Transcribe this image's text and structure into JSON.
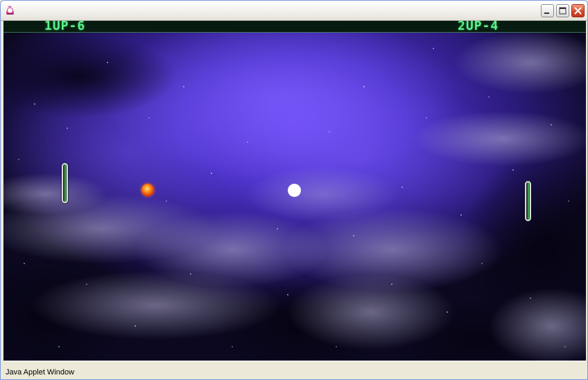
{
  "window": {
    "title": "",
    "status_text": "Java Applet Window"
  },
  "hud": {
    "player1_label": "1UP",
    "player1_score": 6,
    "player1_text": "1UP-6",
    "player2_label": "2UP",
    "player2_score": 4,
    "player2_text": "2UP-4"
  },
  "objects": {
    "left_paddle": "green-capsule-paddle",
    "right_paddle": "green-capsule-paddle",
    "fireball": "orange-fireball",
    "ball": "white-ball"
  },
  "colors": {
    "score_text": "#5cf08a",
    "nebula": "#5a3ad8",
    "space": "#0a0716",
    "fireball": "#e84a0e",
    "ball": "#ffffff",
    "status_bar": "#ECE9D8"
  },
  "icons": {
    "app": "java-applet-icon",
    "minimize": "minimize-icon",
    "maximize": "maximize-icon",
    "close": "close-icon"
  }
}
